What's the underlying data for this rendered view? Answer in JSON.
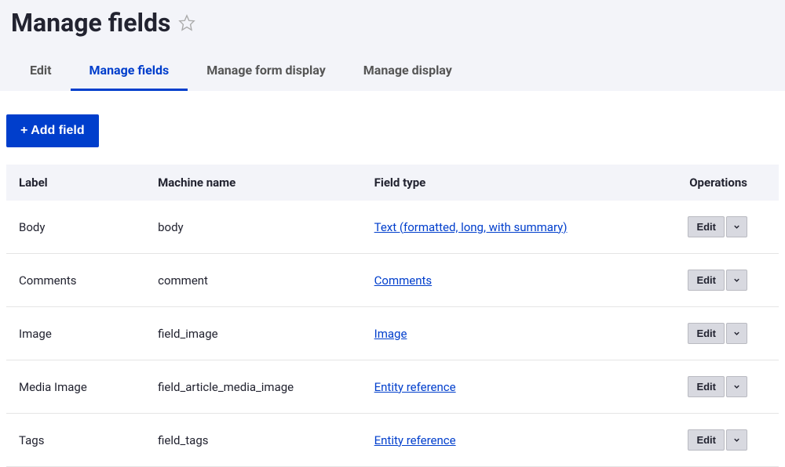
{
  "page": {
    "title": "Manage fields"
  },
  "tabs": [
    {
      "label": "Edit",
      "active": false
    },
    {
      "label": "Manage fields",
      "active": true
    },
    {
      "label": "Manage form display",
      "active": false
    },
    {
      "label": "Manage display",
      "active": false
    }
  ],
  "buttons": {
    "add_field": "+ Add field"
  },
  "table": {
    "headers": {
      "label": "Label",
      "machine_name": "Machine name",
      "field_type": "Field type",
      "operations": "Operations"
    },
    "rows": [
      {
        "label": "Body",
        "machine_name": "body",
        "field_type": "Text (formatted, long, with summary)",
        "op": "Edit"
      },
      {
        "label": "Comments",
        "machine_name": "comment",
        "field_type": "Comments",
        "op": "Edit"
      },
      {
        "label": "Image",
        "machine_name": "field_image",
        "field_type": "Image",
        "op": "Edit"
      },
      {
        "label": "Media Image",
        "machine_name": "field_article_media_image",
        "field_type": "Entity reference",
        "op": "Edit"
      },
      {
        "label": "Tags",
        "machine_name": "field_tags",
        "field_type": "Entity reference",
        "op": "Edit"
      }
    ]
  }
}
